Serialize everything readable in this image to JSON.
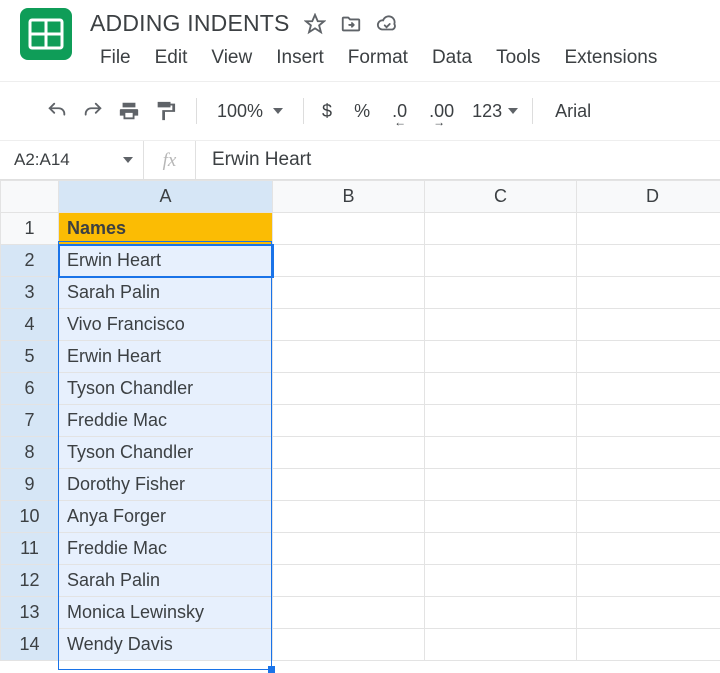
{
  "doc": {
    "title": "ADDING INDENTS"
  },
  "menus": [
    "File",
    "Edit",
    "View",
    "Insert",
    "Format",
    "Data",
    "Tools",
    "Extensions"
  ],
  "toolbar": {
    "zoom": "100%",
    "font": "Arial"
  },
  "name_box": {
    "value": "A2:A14"
  },
  "fx_label": "fx",
  "formula": {
    "value": "Erwin Heart"
  },
  "columns": [
    "A",
    "B",
    "C",
    "D"
  ],
  "rows": [
    "1",
    "2",
    "3",
    "4",
    "5",
    "6",
    "7",
    "8",
    "9",
    "10",
    "11",
    "12",
    "13",
    "14"
  ],
  "cells": {
    "header_label": "Names",
    "names": [
      "Erwin Heart",
      "Sarah Palin",
      "Vivo Francisco",
      "Erwin Heart",
      "Tyson Chandler",
      "Freddie Mac",
      "Tyson Chandler",
      "Dorothy Fisher",
      "Anya Forger",
      "Freddie Mac",
      "Sarah Palin",
      "Monica Lewinsky",
      "Wendy Davis"
    ]
  },
  "number_formats": {
    "more123": "123"
  }
}
